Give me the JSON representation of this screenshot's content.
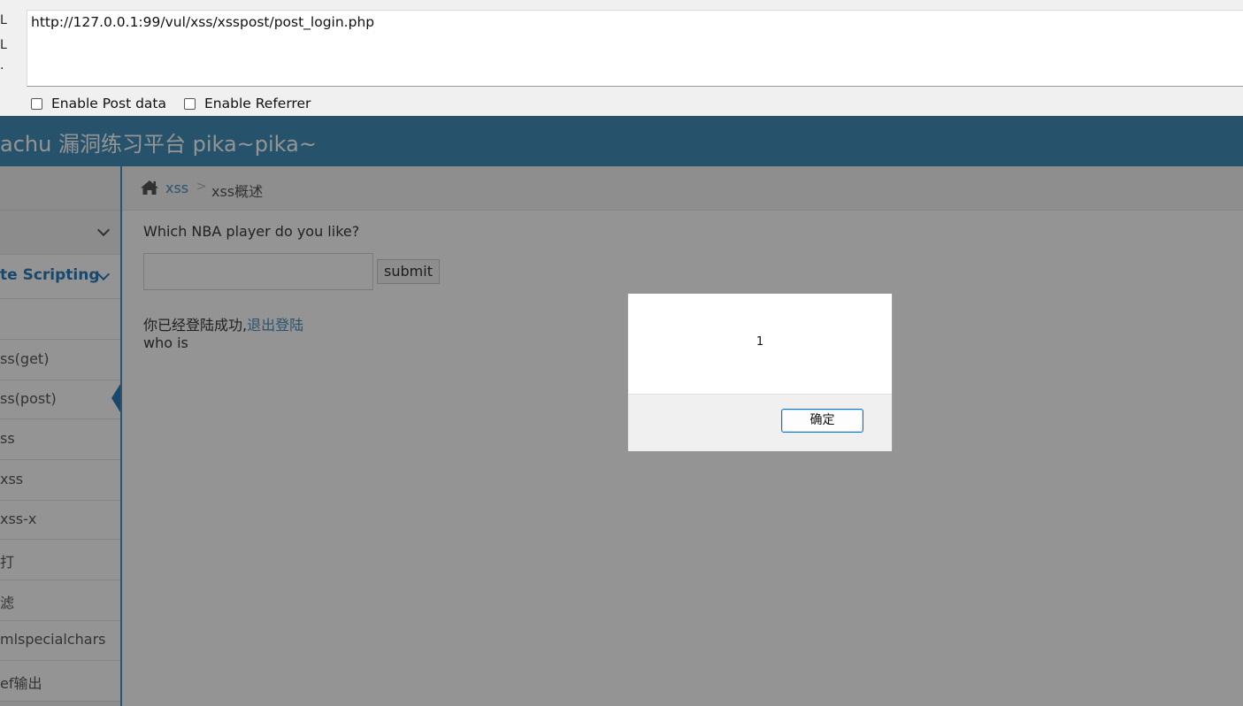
{
  "hackbar": {
    "side_labels": [
      "L",
      "L",
      "."
    ],
    "url": "http://127.0.0.1:99/vul/xss/xsspost/post_login.php",
    "enable_post_label": "Enable Post data",
    "enable_referrer_label": "Enable Referrer"
  },
  "header": {
    "title": "achu 漏洞练习平台 pika~pika~"
  },
  "sidebar": {
    "items": [
      {
        "label": ""
      },
      {
        "label": ""
      },
      {
        "label": "te Scripting"
      },
      {
        "label": ""
      },
      {
        "label": "ss(get)"
      },
      {
        "label": "ss(post)"
      },
      {
        "label": "ss"
      },
      {
        "label": "xss"
      },
      {
        "label": "xss-x"
      },
      {
        "label": "打"
      },
      {
        "label": "滤"
      },
      {
        "label": "mlspecialchars"
      },
      {
        "label": "ef输出"
      }
    ]
  },
  "breadcrumb": {
    "link": "xss",
    "separator": ">",
    "current": "xss概述"
  },
  "main": {
    "question": "Which NBA player do you like?",
    "submit_label": "submit",
    "login_text": "你已经登陆成功,",
    "logout_link": "退出登陆",
    "who_text": "who is"
  },
  "dialog": {
    "message": "1",
    "ok_label": "确定"
  }
}
